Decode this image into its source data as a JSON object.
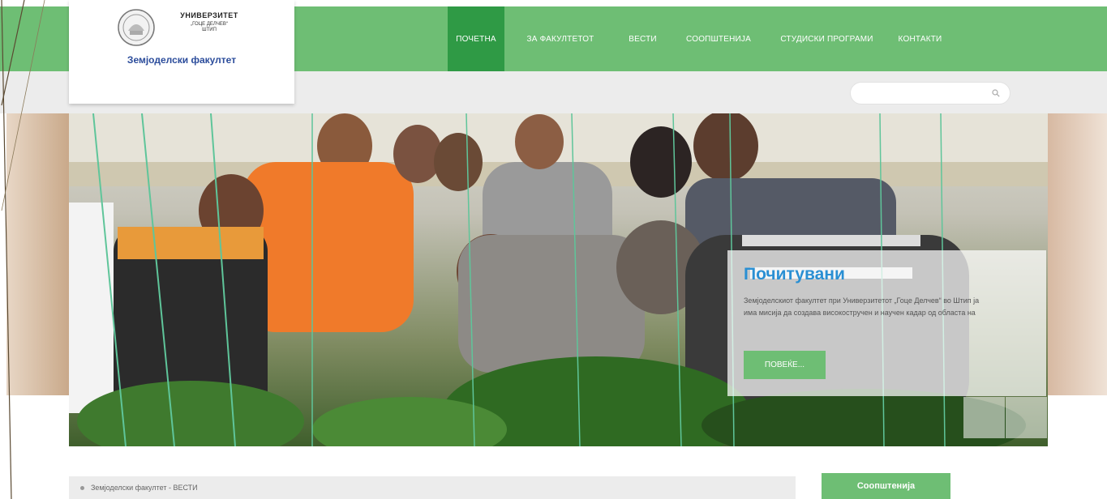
{
  "university": {
    "name": "УНИВЕРЗИТЕТ",
    "subname": "„ГОЦЕ ДЕЛЧЕВ“",
    "city": "ШТИП",
    "faculty": "Земјоделски факултет"
  },
  "nav": {
    "items": [
      {
        "label": "ПОЧЕТНА"
      },
      {
        "label": "ЗА ФАКУЛТЕТОТ"
      },
      {
        "label": "ВЕСТИ"
      },
      {
        "label": "СООПШТЕНИЈА"
      },
      {
        "label": "СТУДИСКИ ПРОГРАМИ"
      },
      {
        "label": "КОНТАКТИ"
      }
    ],
    "active_index": 0
  },
  "search": {
    "placeholder": "",
    "icon": "search-icon"
  },
  "hero": {
    "caption_title": "Почитувани",
    "caption_text": "Земјоделскиот факултет при Универзитетот „Гоце Делчев“ во Штип ја има мисија да создава високостручен и научен кадар од областа на",
    "more_button": "ПОВЕЌЕ..."
  },
  "breadcrumb": {
    "text": "Земјоделски факултет - ВЕСТИ"
  },
  "sidebar": {
    "notices_button": "Соопштенија"
  },
  "colors": {
    "nav_green": "#6ebe74",
    "nav_active": "#2f9a45",
    "caption_blue": "#2a8fd3",
    "faculty_blue": "#2b4c9b"
  }
}
